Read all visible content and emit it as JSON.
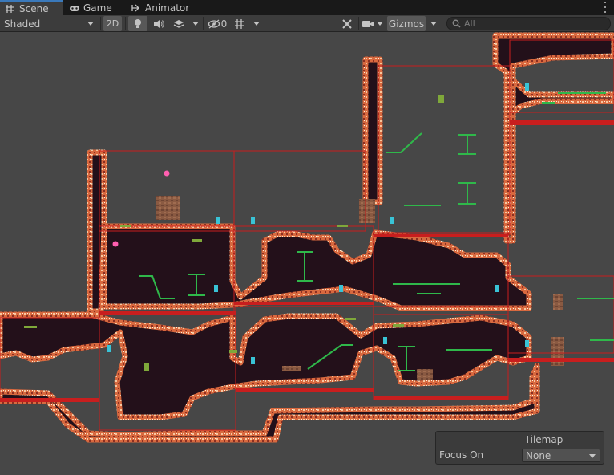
{
  "tabs": [
    {
      "label": "Scene",
      "icon": "grid-icon",
      "active": true
    },
    {
      "label": "Game",
      "icon": "gamepad-icon",
      "active": false
    },
    {
      "label": "Animator",
      "icon": "animator-icon",
      "active": false
    }
  ],
  "toolbar": {
    "draw_mode": "Shaded",
    "mode_2d": "2D",
    "hidden_count": "0",
    "gizmos_label": "Gizmos",
    "search_placeholder": "All"
  },
  "overlay": {
    "title": "Tilemap",
    "focus_label": "Focus On",
    "focus_value": "None"
  },
  "colors": {
    "tabbar_bg": "#191919",
    "toolbar_bg": "#3c3c3c",
    "scene_bg": "#474747",
    "cave_fill": "#23101a",
    "cave_edge": "#e8794e",
    "room_outline": "#c81e1e",
    "platform_green": "#2fb84a",
    "door_cyan": "#39c3d6",
    "accent_blue": "#3a79bb"
  }
}
